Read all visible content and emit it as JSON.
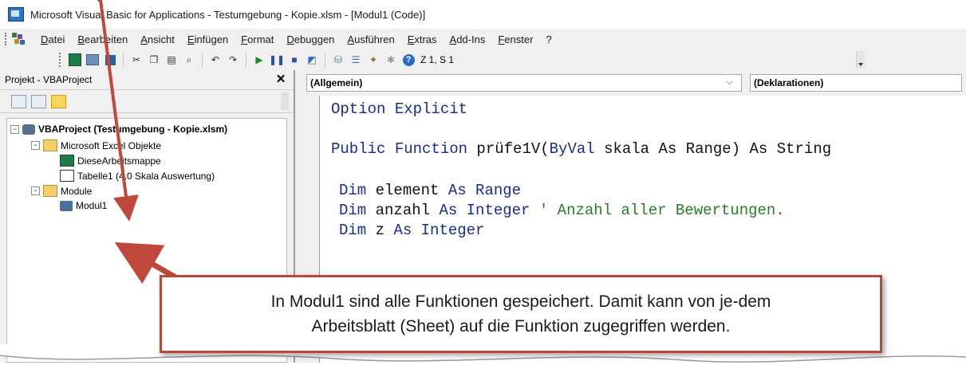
{
  "window": {
    "title": "Microsoft Visual Basic for Applications - Testumgebung - Kopie.xlsm - [Modul1 (Code)]"
  },
  "menu": {
    "items": [
      "Datei",
      "Bearbeiten",
      "Ansicht",
      "Einfügen",
      "Format",
      "Debuggen",
      "Ausführen",
      "Extras",
      "Add-Ins",
      "Fenster",
      "?"
    ]
  },
  "toolbar": {
    "position": "Z 1, S 1"
  },
  "project_explorer": {
    "title": "Projekt - VBAProject",
    "close_label": "×",
    "tree": {
      "root": "VBAProject (Testumgebung - Kopie.xlsm)",
      "excel_objects": "Microsoft Excel Objekte",
      "this_workbook": "DieseArbeitsmappe",
      "sheet": "Tabelle1 (4.0 Skala Auswertung)",
      "modules": "Module",
      "module1": "Modul1"
    }
  },
  "code_window": {
    "object_combo": "(Allgemein)",
    "procedure_combo": "(Deklarationen)",
    "lines": [
      {
        "kw1": "Option Explicit",
        "rest": "",
        "kw2": "",
        "tail": "",
        "comment": ""
      },
      {
        "kw1": "Public Function",
        "rest": " prüfe1V(",
        "kw2": "ByVal",
        "tail": " skala As Range) As String",
        "comment": ""
      },
      {
        "kw1": "Dim",
        "rest": " element ",
        "kw2": "As Range",
        "tail": "",
        "comment": ""
      },
      {
        "kw1": "Dim",
        "rest": " anzahl ",
        "kw2": "As Integer",
        "tail": " ",
        "comment": "' Anzahl aller Bewertungen."
      },
      {
        "kw1": "Dim",
        "rest": " z ",
        "kw2": "As Integer",
        "tail": "",
        "comment": ""
      }
    ]
  },
  "annotation": {
    "text": "In Modul1 sind alle Funktionen gespeichert. Damit kann von je-dem Arbeitsblatt (Sheet) auf die Funktion zugegriffen werden."
  },
  "colors": {
    "annotation_border": "#b5493c",
    "arrow": "#c0473b",
    "keyword": "#1a2c8e",
    "comment": "#2b7d2b"
  }
}
